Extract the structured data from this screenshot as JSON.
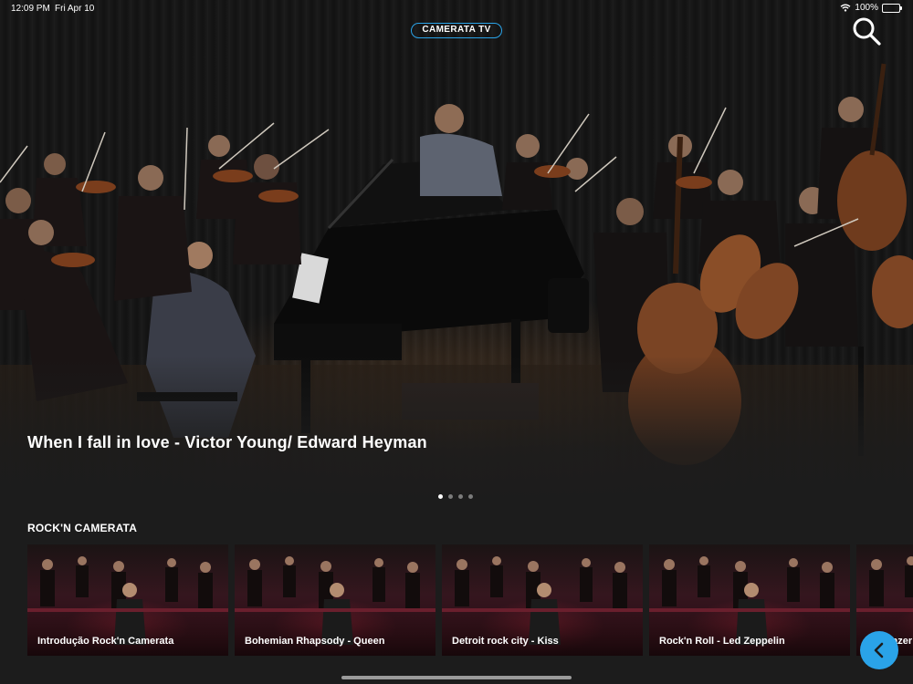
{
  "status_bar": {
    "time": "12:09 PM",
    "date": "Fri Apr 10",
    "battery": "100%",
    "battery_level": 1.0
  },
  "app": {
    "logo_text": "CAMERATA TV",
    "accent_color": "#2aa3e8",
    "search_icon": "search-icon",
    "back_icon": "chevron-left-icon"
  },
  "hero": {
    "title": "When I fall in love - Victor Young/ Edward Heyman",
    "page_count": 4,
    "active_page": 1
  },
  "section": {
    "title": "ROCK'N CAMERATA",
    "items": [
      {
        "label": "Introdução Rock'n Camerata"
      },
      {
        "label": "Bohemian Rhapsody - Queen"
      },
      {
        "label": "Detroit rock city - Kiss"
      },
      {
        "label": "Rock'n Roll - Led Zeppelin"
      },
      {
        "label": "Stargazer"
      }
    ]
  }
}
